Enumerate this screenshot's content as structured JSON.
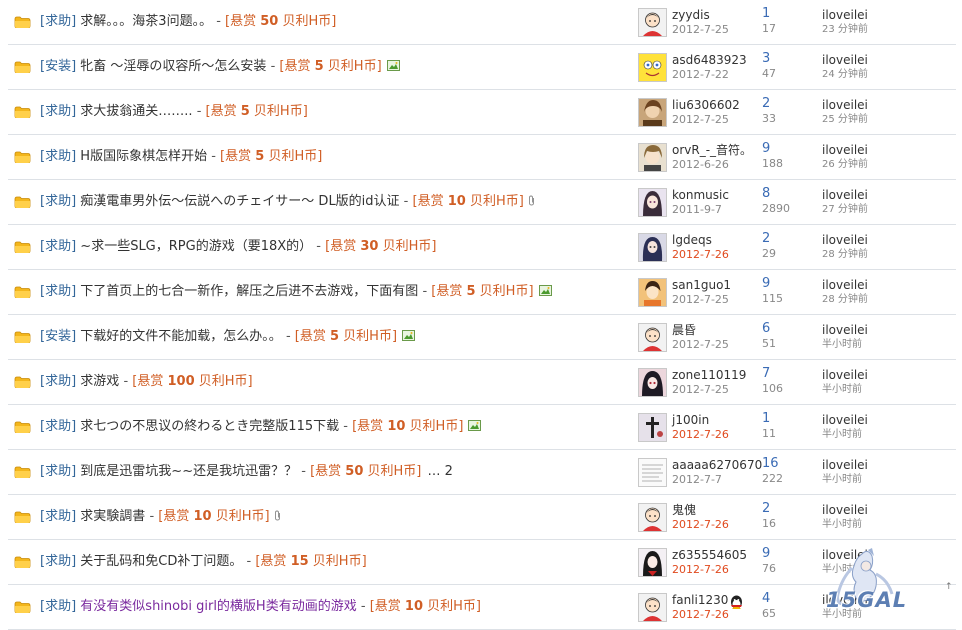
{
  "threads": [
    {
      "category": "[求助]",
      "title": "求解。。。海茶3问题。。",
      "reward_pre": "[悬赏 ",
      "reward_amount": "50",
      "reward_post": " 贝利H币]",
      "img": false,
      "attach": false,
      "pages": "",
      "author": "zyydis",
      "post_date": "2012-7-25",
      "date_new": false,
      "replies": "1",
      "views": "17",
      "last_poster": "iloveilei",
      "last_time": "23 分钟前",
      "avatar": "boy",
      "highlight": false
    },
    {
      "category": "[安装]",
      "title": "牝畜 ～淫辱の収容所～怎么安装",
      "reward_pre": "[悬赏 ",
      "reward_amount": "5",
      "reward_post": " 贝利H币]",
      "img": true,
      "attach": false,
      "pages": "",
      "author": "asd6483923",
      "post_date": "2012-7-22",
      "date_new": false,
      "replies": "3",
      "views": "47",
      "last_poster": "iloveilei",
      "last_time": "24 分钟前",
      "avatar": "sponge",
      "highlight": false
    },
    {
      "category": "[求助]",
      "title": "求大拔翁通关……..",
      "reward_pre": "[悬赏 ",
      "reward_amount": "5",
      "reward_post": " 贝利H币]",
      "img": false,
      "attach": false,
      "pages": "",
      "author": "liu6306602",
      "post_date": "2012-7-25",
      "date_new": false,
      "replies": "2",
      "views": "33",
      "last_poster": "iloveilei",
      "last_time": "25 分钟前",
      "avatar": "brown",
      "highlight": false
    },
    {
      "category": "[求助]",
      "title": "H版国际象棋怎样开始",
      "reward_pre": "[悬赏 ",
      "reward_amount": "5",
      "reward_post": " 贝利H币]",
      "img": false,
      "attach": false,
      "pages": "",
      "author": "orvR_-_音符。",
      "post_date": "2012-6-26",
      "date_new": false,
      "replies": "9",
      "views": "188",
      "last_poster": "iloveilei",
      "last_time": "26 分钟前",
      "avatar": "anime2",
      "highlight": false
    },
    {
      "category": "[求助]",
      "title": "痴漢電車男外伝～伝説へのチェイサー～ DL版的id认证",
      "reward_pre": "[悬赏 ",
      "reward_amount": "10",
      "reward_post": " 贝利H币]",
      "img": false,
      "attach": true,
      "pages": "",
      "author": "konmusic",
      "post_date": "2011-9-7",
      "date_new": false,
      "replies": "8",
      "views": "2890",
      "last_poster": "iloveilei",
      "last_time": "27 分钟前",
      "avatar": "anime3",
      "highlight": false
    },
    {
      "category": "[求助]",
      "title": "~求一些SLG，RPG的游戏（要18X的）",
      "reward_pre": "[悬赏 ",
      "reward_amount": "30",
      "reward_post": " 贝利H币]",
      "img": false,
      "attach": false,
      "pages": "",
      "author": "lgdeqs",
      "post_date": "2012-7-26",
      "date_new": true,
      "replies": "2",
      "views": "29",
      "last_poster": "iloveilei",
      "last_time": "28 分钟前",
      "avatar": "anime4",
      "highlight": false
    },
    {
      "category": "[求助]",
      "title": "下了首页上的七合一新作，解压之后进不去游戏，下面有图",
      "reward_pre": "[悬赏 ",
      "reward_amount": "5",
      "reward_post": " 贝利H币]",
      "img": true,
      "attach": false,
      "pages": "",
      "author": "san1guo1",
      "post_date": "2012-7-25",
      "date_new": false,
      "replies": "9",
      "views": "115",
      "last_poster": "iloveilei",
      "last_time": "28 分钟前",
      "avatar": "anime5",
      "highlight": false
    },
    {
      "category": "[安装]",
      "title": "下载好的文件不能加载，怎么办。。",
      "reward_pre": "[悬赏 ",
      "reward_amount": "5",
      "reward_post": " 贝利H币]",
      "img": true,
      "attach": false,
      "pages": "",
      "author": "晨昏",
      "post_date": "2012-7-25",
      "date_new": false,
      "replies": "6",
      "views": "51",
      "last_poster": "iloveilei",
      "last_time": "半小时前",
      "avatar": "boy",
      "highlight": false
    },
    {
      "category": "[求助]",
      "title": "求游戏",
      "reward_pre": "[悬赏 ",
      "reward_amount": "100",
      "reward_post": " 贝利H币]",
      "img": false,
      "attach": false,
      "pages": "",
      "author": "zone110119",
      "post_date": "2012-7-25",
      "date_new": false,
      "replies": "7",
      "views": "106",
      "last_poster": "iloveilei",
      "last_time": "半小时前",
      "avatar": "anime6",
      "highlight": false
    },
    {
      "category": "[求助]",
      "title": "求七つの不思议の終わるとき完整版115下载",
      "reward_pre": "[悬赏 ",
      "reward_amount": "10",
      "reward_post": " 贝利H币]",
      "img": true,
      "attach": false,
      "pages": "",
      "author": "j100in",
      "post_date": "2012-7-26",
      "date_new": true,
      "replies": "1",
      "views": "11",
      "last_poster": "iloveilei",
      "last_time": "半小时前",
      "avatar": "cross",
      "highlight": false
    },
    {
      "category": "[求助]",
      "title": "到底是迅雷坑我~~还是我坑迅雷？？",
      "reward_pre": "[悬赏 ",
      "reward_amount": "50",
      "reward_post": " 贝利H币]",
      "img": false,
      "attach": false,
      "pages": "… 2",
      "author": "aaaaa6270670",
      "post_date": "2012-7-7",
      "date_new": false,
      "replies": "16",
      "views": "222",
      "last_poster": "iloveilei",
      "last_time": "半小时前",
      "avatar": "text",
      "highlight": false
    },
    {
      "category": "[求助]",
      "title": "求実験調書",
      "reward_pre": "[悬赏 ",
      "reward_amount": "10",
      "reward_post": " 贝利H币]",
      "img": false,
      "attach": true,
      "pages": "",
      "author": "鬼傀",
      "post_date": "2012-7-26",
      "date_new": true,
      "replies": "2",
      "views": "16",
      "last_poster": "iloveilei",
      "last_time": "半小时前",
      "avatar": "boy",
      "highlight": false
    },
    {
      "category": "[求助]",
      "title": "关于乱码和免CD补丁问题。",
      "reward_pre": "[悬赏 ",
      "reward_amount": "15",
      "reward_post": " 贝利H币]",
      "img": false,
      "attach": false,
      "pages": "",
      "author": "z635554605",
      "post_date": "2012-7-26",
      "date_new": true,
      "replies": "9",
      "views": "76",
      "last_poster": "iloveilei",
      "last_time": "半小时前",
      "avatar": "anime7",
      "highlight": false
    },
    {
      "category": "[求助]",
      "title": "有没有类似shinobi girl的横版H类有动画的游戏",
      "reward_pre": "[悬赏 ",
      "reward_amount": "10",
      "reward_post": " 贝利H币]",
      "img": false,
      "attach": false,
      "pages": "",
      "author": "fanli1230",
      "post_date": "2012-7-26",
      "date_new": true,
      "replies": "4",
      "views": "65",
      "last_poster": "iloveilei",
      "last_time": "半小时前",
      "avatar": "boy",
      "highlight": true,
      "qq": true
    }
  ],
  "watermark": "15GAL",
  "scroll_marker": "↑"
}
